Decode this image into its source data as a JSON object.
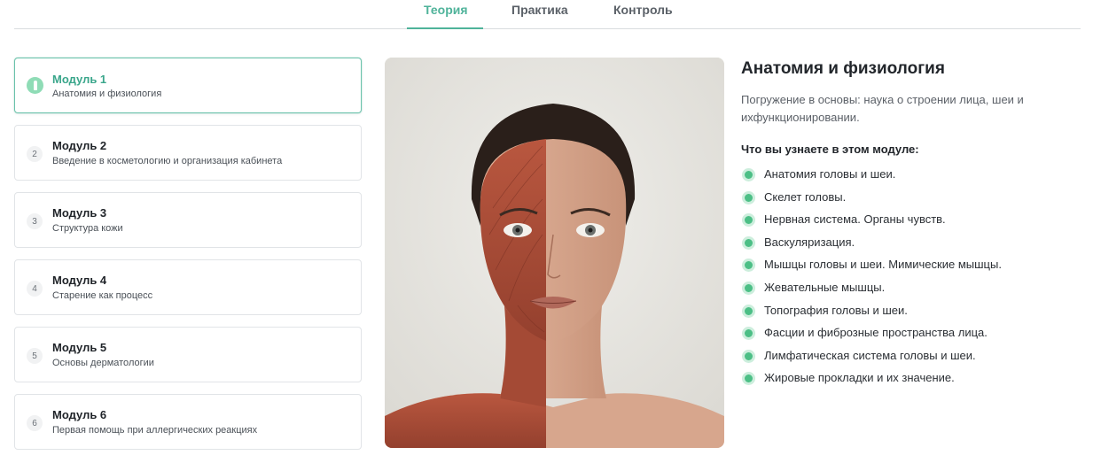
{
  "tabs": [
    {
      "label": "Теория",
      "active": true
    },
    {
      "label": "Практика",
      "active": false
    },
    {
      "label": "Контроль",
      "active": false
    }
  ],
  "modules": [
    {
      "number": "1",
      "title": "Модуль 1",
      "subtitle": "Анатомия и физиология",
      "active": true,
      "icon": "knife-icon"
    },
    {
      "number": "2",
      "title": "Модуль 2",
      "subtitle": "Введение в косметологию и организация кабинета",
      "active": false
    },
    {
      "number": "3",
      "title": "Модуль 3",
      "subtitle": "Структура кожи",
      "active": false
    },
    {
      "number": "4",
      "title": "Модуль 4",
      "subtitle": "Старение как процесс",
      "active": false
    },
    {
      "number": "5",
      "title": "Модуль 5",
      "subtitle": "Основы дерматологии",
      "active": false
    },
    {
      "number": "6",
      "title": "Модуль 6",
      "subtitle": "Первая помощь при аллергических реакциях",
      "active": false
    }
  ],
  "detail": {
    "title": "Анатомия и физиология",
    "description": "Погружение в основы: наука о строении лица, шеи и ихфункционировании.",
    "learn_heading": "Что вы узнаете в этом модуле:",
    "topics": [
      "Анатомия головы и шеи.",
      "Скелет головы.",
      "Нервная система. Органы чувств.",
      "Васкуляризация.",
      "Мышцы головы и шеи. Мимические мышцы.",
      "Жевательные мышцы.",
      "Топография головы и шеи.",
      "Фасции и фиброзные пространства лица.",
      "Лимфатическая система головы и шеи.",
      "Жировые прокладки и их значение."
    ]
  },
  "colors": {
    "accent": "#4fb39a",
    "active_border": "#6ac2ab",
    "bullet": "#4cbf86",
    "bullet_halo": "#cdeedd"
  }
}
